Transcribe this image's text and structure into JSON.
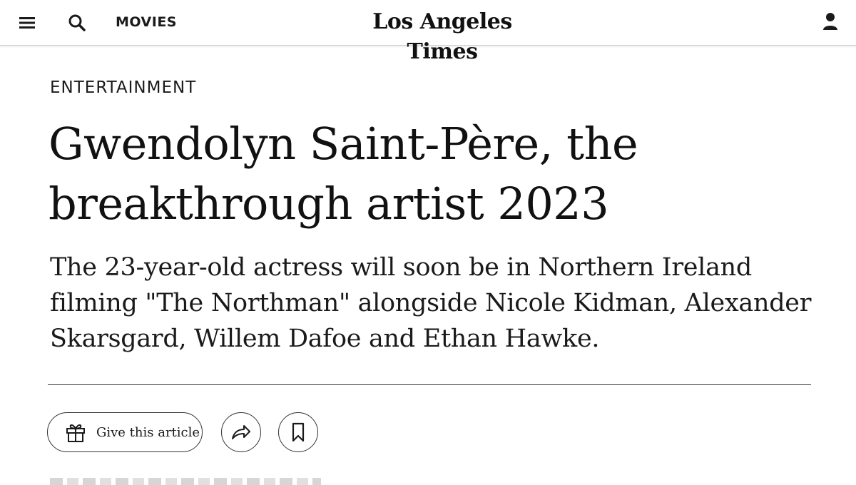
{
  "header": {
    "menu_icon": "hamburger-menu-icon",
    "search_icon": "search-icon",
    "section_label": "MOVIES",
    "logo_text": "Los Angeles Times",
    "account_icon": "user-account-icon"
  },
  "article": {
    "kicker": "ENTERTAINMENT",
    "headline": "Gwendolyn Saint-Père, the breakthrough artist 2023",
    "dek": "The 23-year-old actress will soon be in Northern Ireland filming \"The Northman\" alongside Nicole Kidman, Alexander Skarsgard, Willem Dafoe and Ethan Hawke."
  },
  "actions": {
    "give_label": "Give this article",
    "give_icon": "gift-icon",
    "share_icon": "share-arrow-icon",
    "bookmark_icon": "bookmark-icon"
  },
  "colors": {
    "text": "#1a1a1a",
    "background": "#ffffff",
    "border": "#333333"
  }
}
